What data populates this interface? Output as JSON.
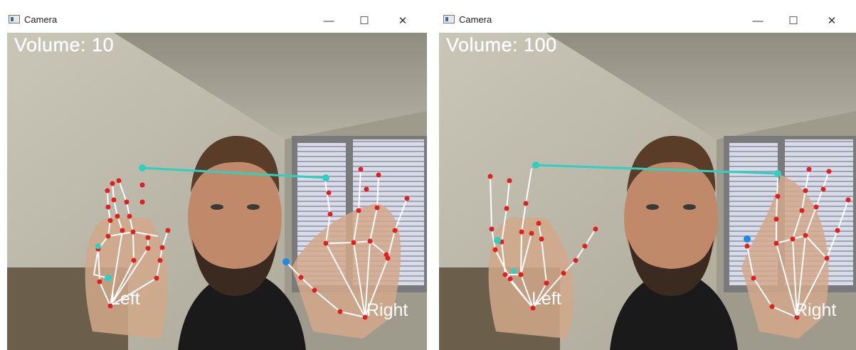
{
  "left_window": {
    "title": "Camera",
    "controls": {
      "minimize": "—",
      "maximize": "☐",
      "close": "✕"
    },
    "volume_text": "Volume: 10",
    "left_label": "Left",
    "right_label": "Right"
  },
  "right_window": {
    "title": "Camera",
    "controls": {
      "minimize": "—",
      "maximize": "☐",
      "close": "✕"
    },
    "volume_text": "Volume: 100",
    "left_label": "Left",
    "right_label": "Right"
  },
  "colors": {
    "landmark": "#e02020",
    "skeleton": "#ffffff",
    "thumb_point": "#30d0c0",
    "link_line": "#30d0c0"
  }
}
